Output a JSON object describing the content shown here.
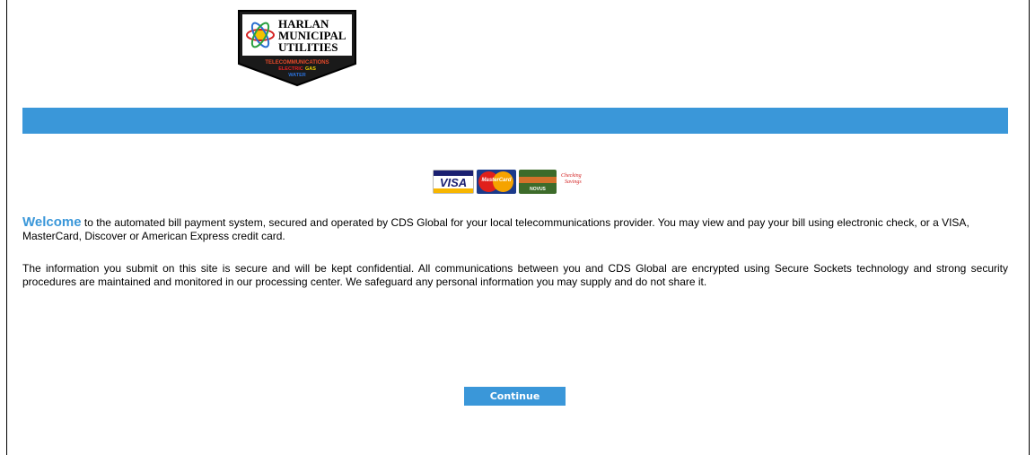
{
  "logo": {
    "line1": "HARLAN",
    "line2": "MUNICIPAL",
    "line3": "UTILITIES",
    "services_1": "TELECOMMUNICATIONS",
    "services_2a": "ELECTRIC",
    "services_2b": "GAS",
    "services_3": "WATER"
  },
  "payment_methods": {
    "visa": "VISA",
    "mastercard": "MasterCard",
    "discover": "NOVUS",
    "check_line1": "Checking",
    "check_line2": "Savings"
  },
  "content": {
    "welcome_word": "Welcome",
    "welcome_rest": " to the automated bill payment system, secured and operated by CDS Global for your local telecommunications provider. You may view and pay your bill using electronic check, or a VISA, MasterCard, Discover or American Express credit card.",
    "security_text": "The information you submit on this site is secure and will be kept confidential. All communications between you and CDS Global are encrypted using Secure Sockets technology and strong security procedures are maintained and monitored in our processing center. We safeguard any personal information you may supply and do not share it."
  },
  "actions": {
    "continue_label": "Continue"
  },
  "colors": {
    "accent": "#3a97d9",
    "logo_border": "#1a1a1a"
  }
}
